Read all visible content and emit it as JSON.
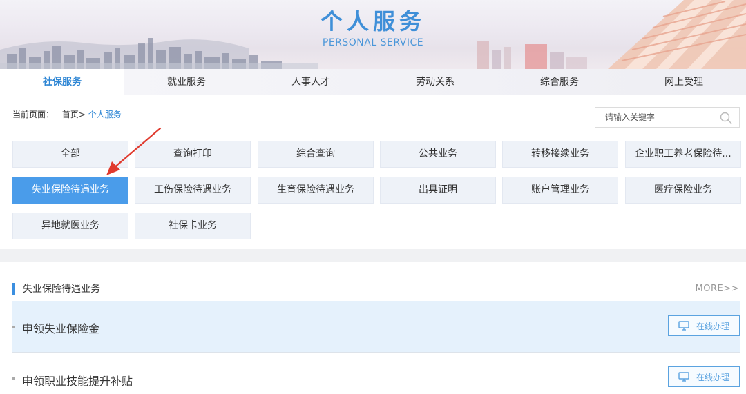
{
  "banner": {
    "title": "个人服务",
    "subtitle": "PERSONAL SERVICE"
  },
  "nav": {
    "items": [
      {
        "label": "社保服务",
        "active": true
      },
      {
        "label": "就业服务"
      },
      {
        "label": "人事人才"
      },
      {
        "label": "劳动关系"
      },
      {
        "label": "综合服务"
      },
      {
        "label": "网上受理"
      }
    ]
  },
  "breadcrumb": {
    "prefix": "当前页面：",
    "home": "首页>",
    "current": "个人服务"
  },
  "search": {
    "placeholder": "请输入关键字",
    "icon": "search-icon"
  },
  "categories": [
    {
      "label": "全部"
    },
    {
      "label": "查询打印"
    },
    {
      "label": "综合查询"
    },
    {
      "label": "公共业务"
    },
    {
      "label": "转移接续业务"
    },
    {
      "label": "企业职工养老保险待..."
    },
    {
      "label": "失业保险待遇业务",
      "active": true
    },
    {
      "label": "工伤保险待遇业务"
    },
    {
      "label": "生育保险待遇业务"
    },
    {
      "label": "出具证明"
    },
    {
      "label": "账户管理业务"
    },
    {
      "label": "医疗保险业务"
    },
    {
      "label": "异地就医业务"
    },
    {
      "label": "社保卡业务"
    }
  ],
  "section": {
    "title": "失业保险待遇业务",
    "more": "MORE>>",
    "items": [
      {
        "label": "申领失业保险金",
        "button": "在线办理"
      },
      {
        "label": "申领职业技能提升补贴",
        "button": "在线办理"
      }
    ]
  },
  "colors": {
    "accent": "#4a9cea",
    "title_blue": "#3f8fd8",
    "annotation_arrow": "#e03a2e"
  }
}
